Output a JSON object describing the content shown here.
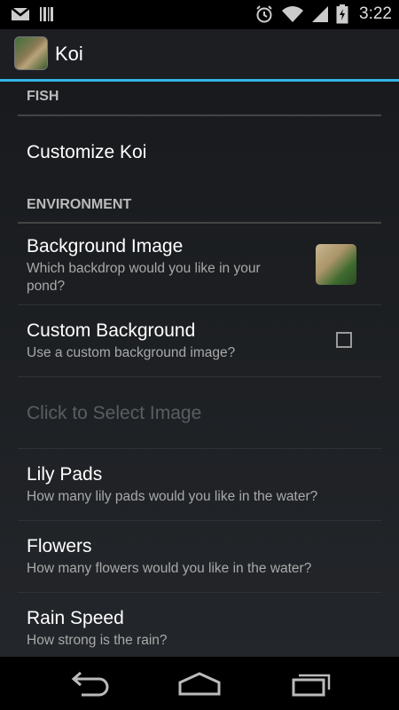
{
  "status_bar": {
    "time": "3:22",
    "icons": [
      "gmail-icon",
      "barcode-icon",
      "alarm-icon",
      "wifi-icon",
      "signal-icon",
      "battery-charging-icon"
    ]
  },
  "action_bar": {
    "title": "Koi",
    "icon": "koi-app-icon"
  },
  "categories": {
    "fish": "FISH",
    "environment": "ENVIRONMENT"
  },
  "prefs": {
    "customize_koi": {
      "title": "Customize Koi"
    },
    "background_image": {
      "title": "Background Image",
      "summary": "Which backdrop would you like in your pond?"
    },
    "custom_background": {
      "title": "Custom Background",
      "summary": "Use a custom background image?",
      "checked": false
    },
    "select_image": {
      "title": "Click to Select Image",
      "enabled": false
    },
    "lily_pads": {
      "title": "Lily Pads",
      "summary": "How many lily pads would you like in the water?"
    },
    "flowers": {
      "title": "Flowers",
      "summary": "How many flowers would you like in the water?"
    },
    "rain_speed": {
      "title": "Rain Speed",
      "summary": "How strong is the rain?"
    }
  },
  "nav_bar": {
    "buttons": [
      "back-icon",
      "home-icon",
      "recents-icon"
    ]
  },
  "colors": {
    "accent": "#33b5e5",
    "background": "#1c1e22"
  }
}
